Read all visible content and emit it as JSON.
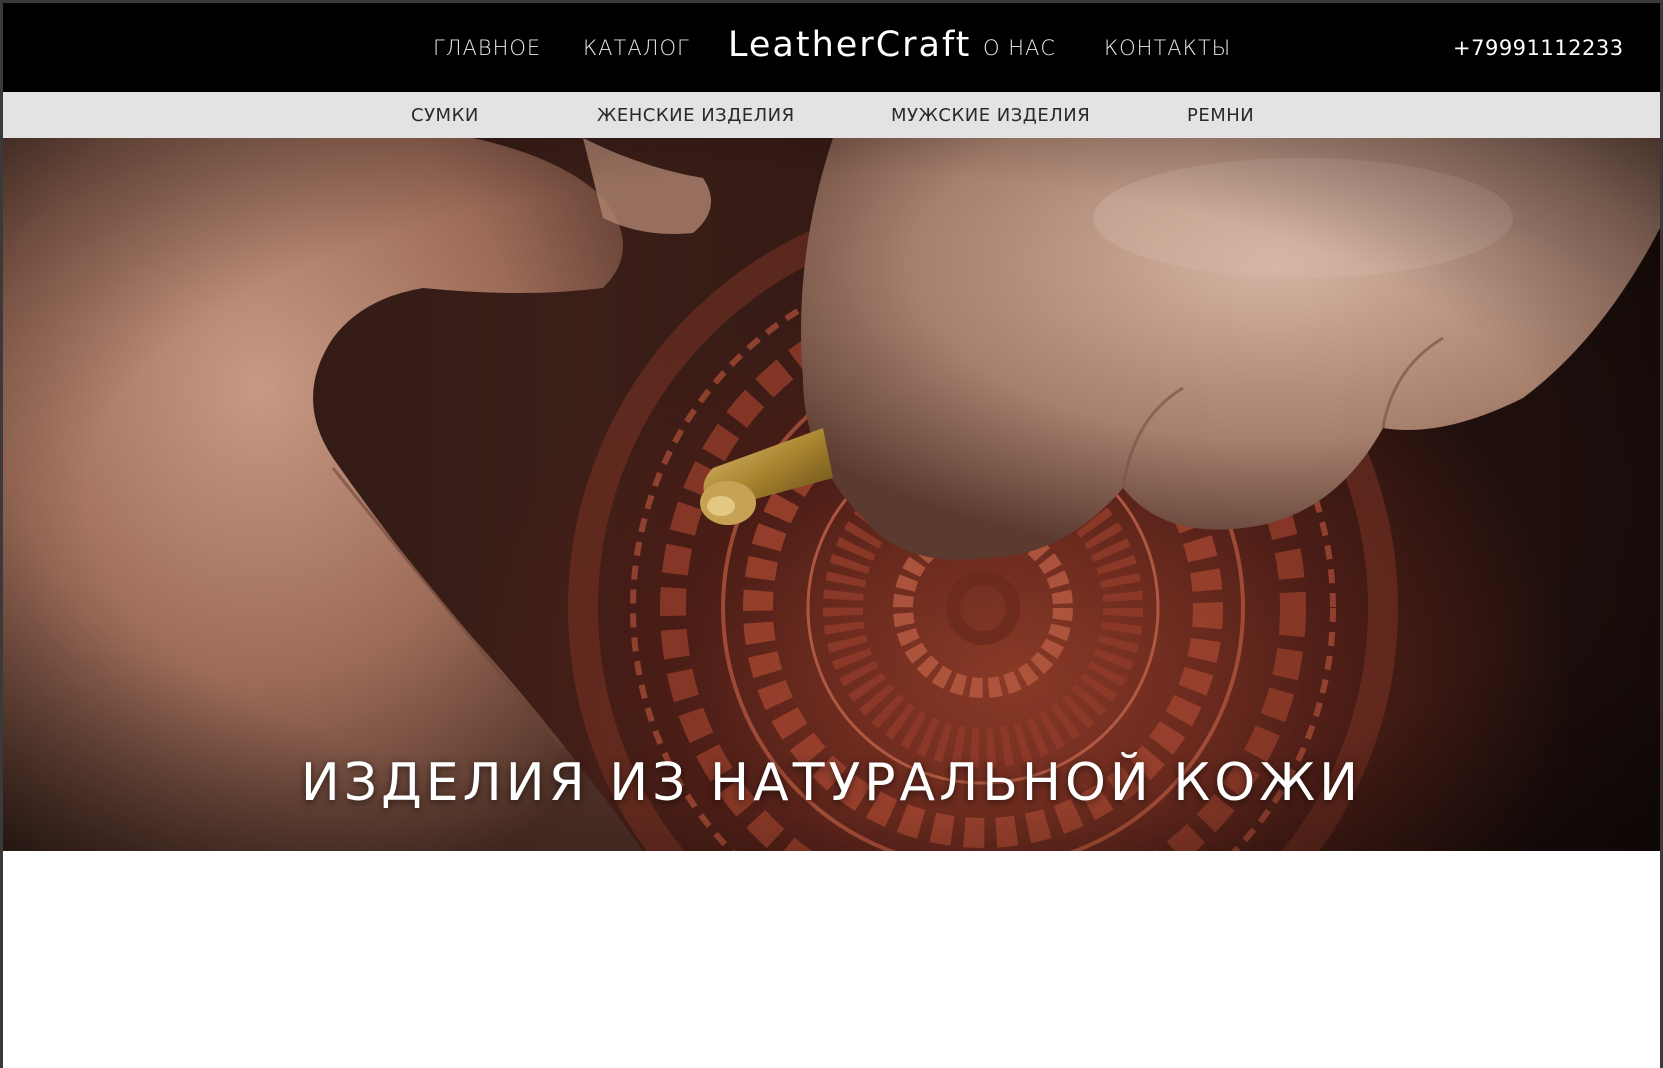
{
  "header": {
    "nav_left": [
      "ГЛАВНОЕ",
      "КАТАЛОГ"
    ],
    "logo": "LeatherCraft",
    "nav_right": [
      "О НАС",
      "КОНТАКТЫ"
    ],
    "phone": "+79991112233"
  },
  "subnav": {
    "items": [
      "СУМКИ",
      "ЖЕНСКИЕ ИЗДЕЛИЯ",
      "МУЖСКИЕ ИЗДЕЛИЯ",
      "РЕМНИ"
    ]
  },
  "hero": {
    "title": "ИЗДЕЛИЯ ИЗ НАТУРАЛЬНОЙ КОЖИ",
    "image": "hands tooling an embossed leather mandala with a brass stamping tool"
  },
  "colors": {
    "header_bg": "#000000",
    "subnav_bg": "#e3e3e3",
    "leather": "#6a2a1e"
  }
}
